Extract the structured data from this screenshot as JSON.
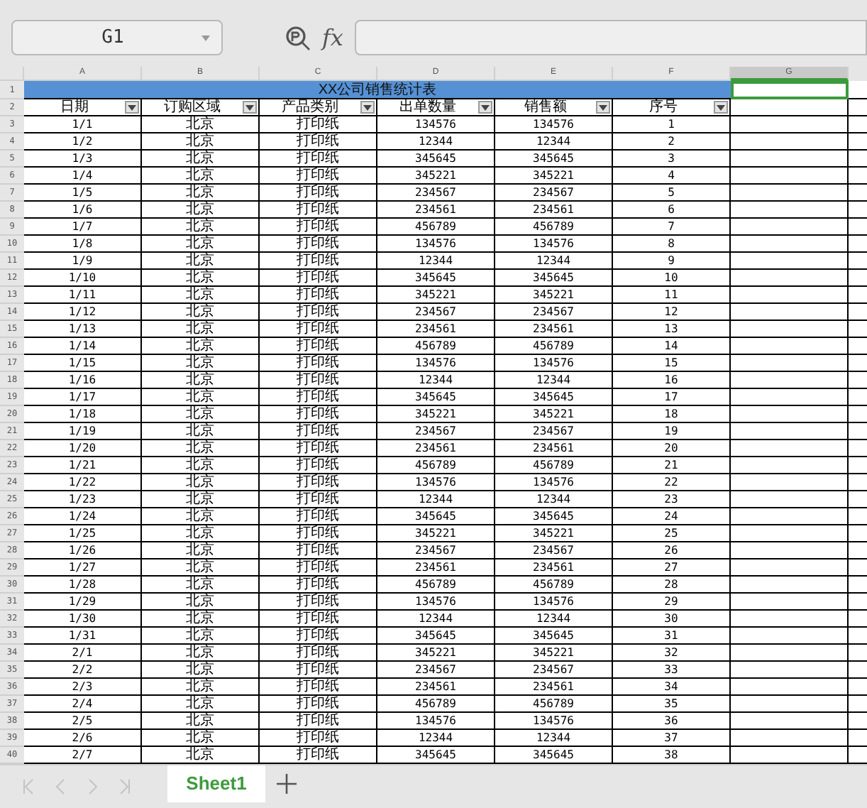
{
  "name_box": "G1",
  "formula_label": "fx",
  "columns": [
    {
      "label": "A",
      "selected": false
    },
    {
      "label": "B",
      "selected": false
    },
    {
      "label": "C",
      "selected": false
    },
    {
      "label": "D",
      "selected": false
    },
    {
      "label": "E",
      "selected": false
    },
    {
      "label": "F",
      "selected": false
    },
    {
      "label": "G",
      "selected": true
    }
  ],
  "row_numbers": [
    "1",
    "2",
    "3",
    "4",
    "5",
    "6",
    "7",
    "8",
    "9",
    "10",
    "11",
    "12",
    "13",
    "14",
    "15",
    "16",
    "17",
    "18",
    "19",
    "20",
    "21",
    "22",
    "23",
    "24",
    "25",
    "26",
    "27",
    "28",
    "29",
    "30",
    "31",
    "32",
    "33",
    "34",
    "35",
    "36",
    "37",
    "38",
    "39",
    "40"
  ],
  "title": "XX公司销售统计表",
  "headers": [
    "日期",
    "订购区域",
    "产品类别",
    "出单数量",
    "销售额",
    "序号"
  ],
  "rows": [
    [
      "1/1",
      "北京",
      "打印纸",
      "134576",
      "134576",
      "1"
    ],
    [
      "1/2",
      "北京",
      "打印纸",
      "12344",
      "12344",
      "2"
    ],
    [
      "1/3",
      "北京",
      "打印纸",
      "345645",
      "345645",
      "3"
    ],
    [
      "1/4",
      "北京",
      "打印纸",
      "345221",
      "345221",
      "4"
    ],
    [
      "1/5",
      "北京",
      "打印纸",
      "234567",
      "234567",
      "5"
    ],
    [
      "1/6",
      "北京",
      "打印纸",
      "234561",
      "234561",
      "6"
    ],
    [
      "1/7",
      "北京",
      "打印纸",
      "456789",
      "456789",
      "7"
    ],
    [
      "1/8",
      "北京",
      "打印纸",
      "134576",
      "134576",
      "8"
    ],
    [
      "1/9",
      "北京",
      "打印纸",
      "12344",
      "12344",
      "9"
    ],
    [
      "1/10",
      "北京",
      "打印纸",
      "345645",
      "345645",
      "10"
    ],
    [
      "1/11",
      "北京",
      "打印纸",
      "345221",
      "345221",
      "11"
    ],
    [
      "1/12",
      "北京",
      "打印纸",
      "234567",
      "234567",
      "12"
    ],
    [
      "1/13",
      "北京",
      "打印纸",
      "234561",
      "234561",
      "13"
    ],
    [
      "1/14",
      "北京",
      "打印纸",
      "456789",
      "456789",
      "14"
    ],
    [
      "1/15",
      "北京",
      "打印纸",
      "134576",
      "134576",
      "15"
    ],
    [
      "1/16",
      "北京",
      "打印纸",
      "12344",
      "12344",
      "16"
    ],
    [
      "1/17",
      "北京",
      "打印纸",
      "345645",
      "345645",
      "17"
    ],
    [
      "1/18",
      "北京",
      "打印纸",
      "345221",
      "345221",
      "18"
    ],
    [
      "1/19",
      "北京",
      "打印纸",
      "234567",
      "234567",
      "19"
    ],
    [
      "1/20",
      "北京",
      "打印纸",
      "234561",
      "234561",
      "20"
    ],
    [
      "1/21",
      "北京",
      "打印纸",
      "456789",
      "456789",
      "21"
    ],
    [
      "1/22",
      "北京",
      "打印纸",
      "134576",
      "134576",
      "22"
    ],
    [
      "1/23",
      "北京",
      "打印纸",
      "12344",
      "12344",
      "23"
    ],
    [
      "1/24",
      "北京",
      "打印纸",
      "345645",
      "345645",
      "24"
    ],
    [
      "1/25",
      "北京",
      "打印纸",
      "345221",
      "345221",
      "25"
    ],
    [
      "1/26",
      "北京",
      "打印纸",
      "234567",
      "234567",
      "26"
    ],
    [
      "1/27",
      "北京",
      "打印纸",
      "234561",
      "234561",
      "27"
    ],
    [
      "1/28",
      "北京",
      "打印纸",
      "456789",
      "456789",
      "28"
    ],
    [
      "1/29",
      "北京",
      "打印纸",
      "134576",
      "134576",
      "29"
    ],
    [
      "1/30",
      "北京",
      "打印纸",
      "12344",
      "12344",
      "30"
    ],
    [
      "1/31",
      "北京",
      "打印纸",
      "345645",
      "345645",
      "31"
    ],
    [
      "2/1",
      "北京",
      "打印纸",
      "345221",
      "345221",
      "32"
    ],
    [
      "2/2",
      "北京",
      "打印纸",
      "234567",
      "234567",
      "33"
    ],
    [
      "2/3",
      "北京",
      "打印纸",
      "234561",
      "234561",
      "34"
    ],
    [
      "2/4",
      "北京",
      "打印纸",
      "456789",
      "456789",
      "35"
    ],
    [
      "2/5",
      "北京",
      "打印纸",
      "134576",
      "134576",
      "36"
    ],
    [
      "2/6",
      "北京",
      "打印纸",
      "12344",
      "12344",
      "37"
    ],
    [
      "2/7",
      "北京",
      "打印纸",
      "345645",
      "345645",
      "38"
    ]
  ],
  "sheet_tabs": [
    {
      "label": "Sheet1",
      "selected": true
    }
  ]
}
